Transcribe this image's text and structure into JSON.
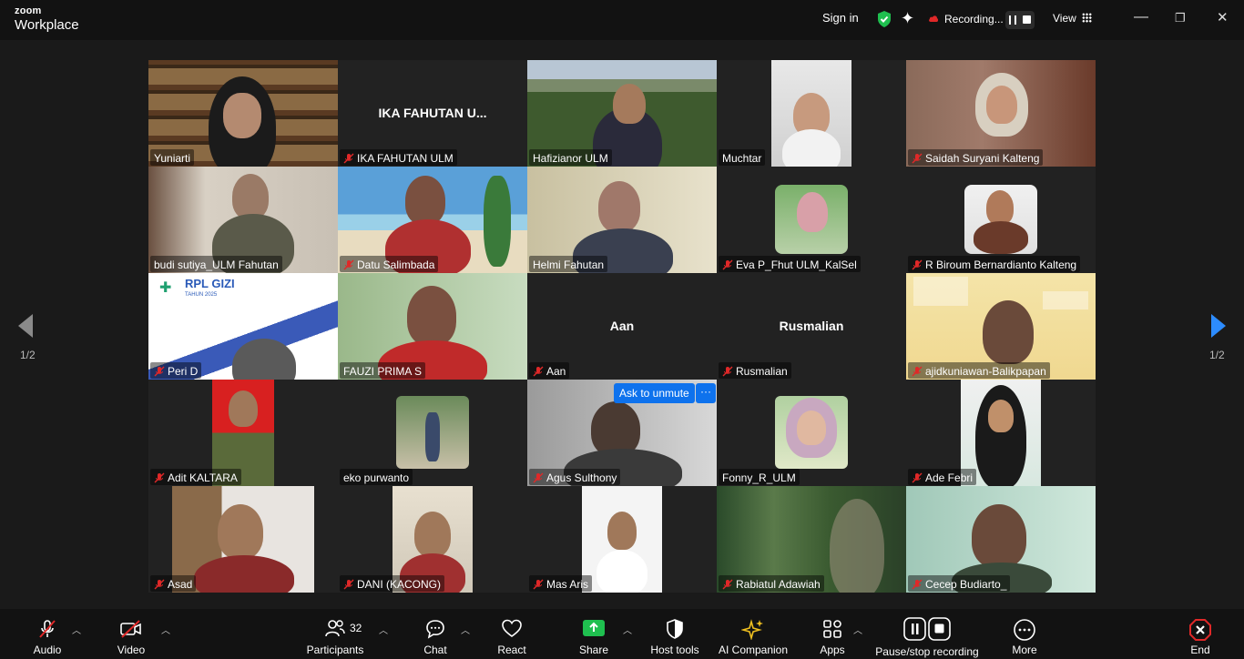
{
  "app": {
    "brand_top": "zoom",
    "brand_bottom": "Workplace"
  },
  "titlebar": {
    "sign_in": "Sign in",
    "recording": "Recording...",
    "view": "View"
  },
  "colors": {
    "active_speaker": "#2ed17a",
    "accent": "#0e72ed",
    "mute": "#e02828",
    "end": "#e02828",
    "share": "#1fbf4f"
  },
  "tiles": [
    {
      "name": "Yuniarti",
      "muted": false
    },
    {
      "name": "IKA FAHUTAN ULM",
      "muted": true,
      "display": "IKA FAHUTAN U..."
    },
    {
      "name": "Hafizianor ULM",
      "muted": false
    },
    {
      "name": "Muchtar",
      "muted": false
    },
    {
      "name": "Saidah Suryani Kalteng",
      "muted": true
    },
    {
      "name": "budi sutiya_ULM Fahutan",
      "muted": false
    },
    {
      "name": "Datu Salimbada",
      "muted": true
    },
    {
      "name": "Helmi Fahutan",
      "muted": false
    },
    {
      "name": "Eva P_Fhut ULM_KalSel",
      "muted": true
    },
    {
      "name": "R Biroum Bernardianto Kalteng",
      "muted": true
    },
    {
      "name": "Peri D",
      "muted": true
    },
    {
      "name": "FAUZI PRIMA S",
      "muted": false
    },
    {
      "name": "Aan",
      "muted": true,
      "display": "Aan"
    },
    {
      "name": "Rusmalian",
      "muted": true,
      "display": "Rusmalian"
    },
    {
      "name": "ajidkuniawan-Balikpapan",
      "muted": true
    },
    {
      "name": "Adit KALTARA",
      "muted": true
    },
    {
      "name": "eko purwanto",
      "muted": false
    },
    {
      "name": "Agus Sulthony",
      "muted": true
    },
    {
      "name": "Fonny_R_ULM",
      "muted": false
    },
    {
      "name": "Ade Febri",
      "muted": true
    },
    {
      "name": "Asad",
      "muted": true
    },
    {
      "name": "DANI (KACONG)",
      "muted": true
    },
    {
      "name": "Mas Aris",
      "muted": true
    },
    {
      "name": "Rabiatul Adawiah",
      "muted": true
    },
    {
      "name": "Cecep Budiarto_",
      "muted": true
    }
  ],
  "tile_texts": {
    "rpl_title": "RPL GIZI",
    "rpl_sub": "TAHUN 2025",
    "ask_to_unmute": "Ask to unmute",
    "more": "···"
  },
  "pager": {
    "left": "1/2",
    "right": "1/2"
  },
  "toolbar": {
    "audio": "Audio",
    "video": "Video",
    "participants": "Participants",
    "participants_count": "32",
    "chat": "Chat",
    "react": "React",
    "share": "Share",
    "host_tools": "Host tools",
    "ai_companion": "AI Companion",
    "apps": "Apps",
    "pause_stop_recording": "Pause/stop recording",
    "more": "More",
    "end": "End"
  }
}
